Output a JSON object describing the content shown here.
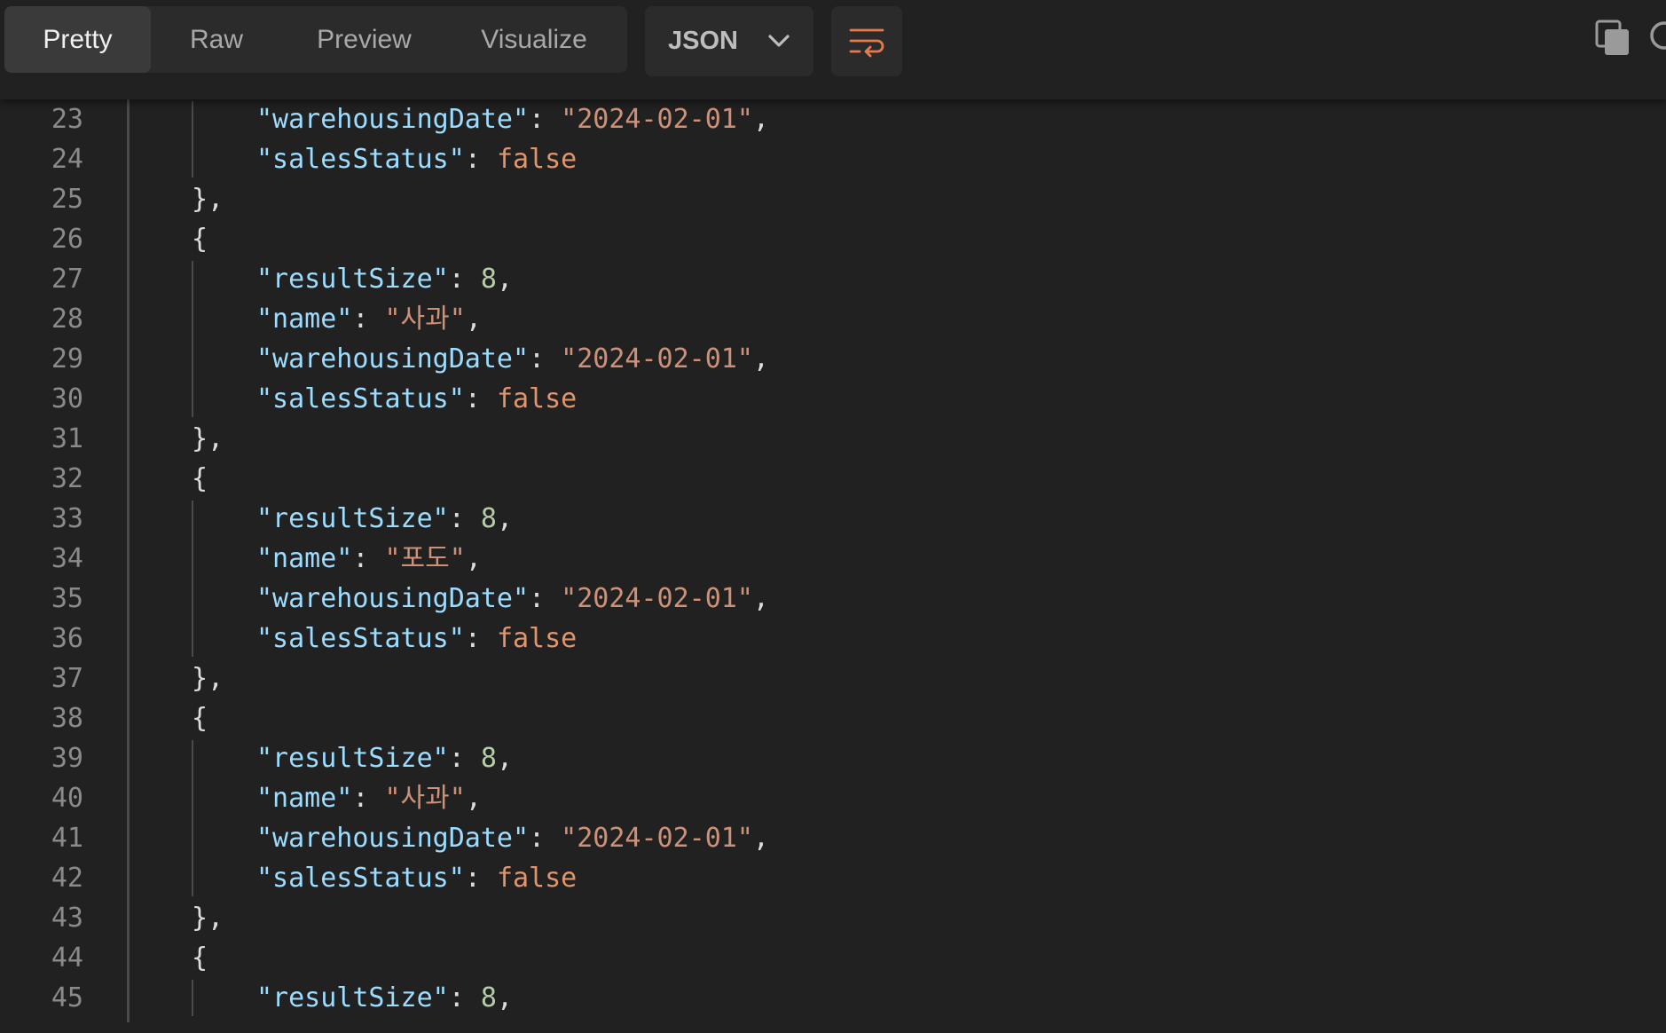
{
  "toolbar": {
    "tabs": [
      {
        "label": "Pretty",
        "active": true
      },
      {
        "label": "Raw",
        "active": false
      },
      {
        "label": "Preview",
        "active": false
      },
      {
        "label": "Visualize",
        "active": false
      }
    ],
    "format_label": "JSON",
    "icons": {
      "format_dropdown": "chevron-down-icon",
      "wrap": "wrap-lines-icon",
      "copy": "copy-icon",
      "search": "search-icon"
    }
  },
  "editor": {
    "colors": {
      "background": "#212121",
      "line_number": "#8a8a8a",
      "key": "#9cdcfe",
      "string": "#ce9178",
      "number": "#b5cea8",
      "boolean": "#e0956d",
      "accent_icon": "#e8794a"
    },
    "lines": [
      {
        "num": "23",
        "indent": 2,
        "tokens": [
          {
            "t": "key",
            "v": "\"warehousingDate\""
          },
          {
            "t": "punc",
            "v": ": "
          },
          {
            "t": "str",
            "v": "\"2024-02-01\""
          },
          {
            "t": "punc",
            "v": ","
          }
        ]
      },
      {
        "num": "24",
        "indent": 2,
        "tokens": [
          {
            "t": "key",
            "v": "\"salesStatus\""
          },
          {
            "t": "punc",
            "v": ": "
          },
          {
            "t": "bool",
            "v": "false"
          }
        ]
      },
      {
        "num": "25",
        "indent": 1,
        "tokens": [
          {
            "t": "punc",
            "v": "},"
          }
        ]
      },
      {
        "num": "26",
        "indent": 1,
        "tokens": [
          {
            "t": "punc",
            "v": "{"
          }
        ]
      },
      {
        "num": "27",
        "indent": 2,
        "tokens": [
          {
            "t": "key",
            "v": "\"resultSize\""
          },
          {
            "t": "punc",
            "v": ": "
          },
          {
            "t": "num",
            "v": "8"
          },
          {
            "t": "punc",
            "v": ","
          }
        ]
      },
      {
        "num": "28",
        "indent": 2,
        "tokens": [
          {
            "t": "key",
            "v": "\"name\""
          },
          {
            "t": "punc",
            "v": ": "
          },
          {
            "t": "str",
            "v": "\"사과\""
          },
          {
            "t": "punc",
            "v": ","
          }
        ]
      },
      {
        "num": "29",
        "indent": 2,
        "tokens": [
          {
            "t": "key",
            "v": "\"warehousingDate\""
          },
          {
            "t": "punc",
            "v": ": "
          },
          {
            "t": "str",
            "v": "\"2024-02-01\""
          },
          {
            "t": "punc",
            "v": ","
          }
        ]
      },
      {
        "num": "30",
        "indent": 2,
        "tokens": [
          {
            "t": "key",
            "v": "\"salesStatus\""
          },
          {
            "t": "punc",
            "v": ": "
          },
          {
            "t": "bool",
            "v": "false"
          }
        ]
      },
      {
        "num": "31",
        "indent": 1,
        "tokens": [
          {
            "t": "punc",
            "v": "},"
          }
        ]
      },
      {
        "num": "32",
        "indent": 1,
        "tokens": [
          {
            "t": "punc",
            "v": "{"
          }
        ]
      },
      {
        "num": "33",
        "indent": 2,
        "tokens": [
          {
            "t": "key",
            "v": "\"resultSize\""
          },
          {
            "t": "punc",
            "v": ": "
          },
          {
            "t": "num",
            "v": "8"
          },
          {
            "t": "punc",
            "v": ","
          }
        ]
      },
      {
        "num": "34",
        "indent": 2,
        "tokens": [
          {
            "t": "key",
            "v": "\"name\""
          },
          {
            "t": "punc",
            "v": ": "
          },
          {
            "t": "str",
            "v": "\"포도\""
          },
          {
            "t": "punc",
            "v": ","
          }
        ]
      },
      {
        "num": "35",
        "indent": 2,
        "tokens": [
          {
            "t": "key",
            "v": "\"warehousingDate\""
          },
          {
            "t": "punc",
            "v": ": "
          },
          {
            "t": "str",
            "v": "\"2024-02-01\""
          },
          {
            "t": "punc",
            "v": ","
          }
        ]
      },
      {
        "num": "36",
        "indent": 2,
        "tokens": [
          {
            "t": "key",
            "v": "\"salesStatus\""
          },
          {
            "t": "punc",
            "v": ": "
          },
          {
            "t": "bool",
            "v": "false"
          }
        ]
      },
      {
        "num": "37",
        "indent": 1,
        "tokens": [
          {
            "t": "punc",
            "v": "},"
          }
        ]
      },
      {
        "num": "38",
        "indent": 1,
        "tokens": [
          {
            "t": "punc",
            "v": "{"
          }
        ]
      },
      {
        "num": "39",
        "indent": 2,
        "tokens": [
          {
            "t": "key",
            "v": "\"resultSize\""
          },
          {
            "t": "punc",
            "v": ": "
          },
          {
            "t": "num",
            "v": "8"
          },
          {
            "t": "punc",
            "v": ","
          }
        ]
      },
      {
        "num": "40",
        "indent": 2,
        "tokens": [
          {
            "t": "key",
            "v": "\"name\""
          },
          {
            "t": "punc",
            "v": ": "
          },
          {
            "t": "str",
            "v": "\"사과\""
          },
          {
            "t": "punc",
            "v": ","
          }
        ]
      },
      {
        "num": "41",
        "indent": 2,
        "tokens": [
          {
            "t": "key",
            "v": "\"warehousingDate\""
          },
          {
            "t": "punc",
            "v": ": "
          },
          {
            "t": "str",
            "v": "\"2024-02-01\""
          },
          {
            "t": "punc",
            "v": ","
          }
        ]
      },
      {
        "num": "42",
        "indent": 2,
        "tokens": [
          {
            "t": "key",
            "v": "\"salesStatus\""
          },
          {
            "t": "punc",
            "v": ": "
          },
          {
            "t": "bool",
            "v": "false"
          }
        ]
      },
      {
        "num": "43",
        "indent": 1,
        "tokens": [
          {
            "t": "punc",
            "v": "},"
          }
        ]
      },
      {
        "num": "44",
        "indent": 1,
        "tokens": [
          {
            "t": "punc",
            "v": "{"
          }
        ]
      },
      {
        "num": "45",
        "indent": 2,
        "tokens": [
          {
            "t": "key",
            "v": "\"resultSize\""
          },
          {
            "t": "punc",
            "v": ": "
          },
          {
            "t": "num",
            "v": "8"
          },
          {
            "t": "punc",
            "v": ","
          }
        ]
      }
    ]
  }
}
